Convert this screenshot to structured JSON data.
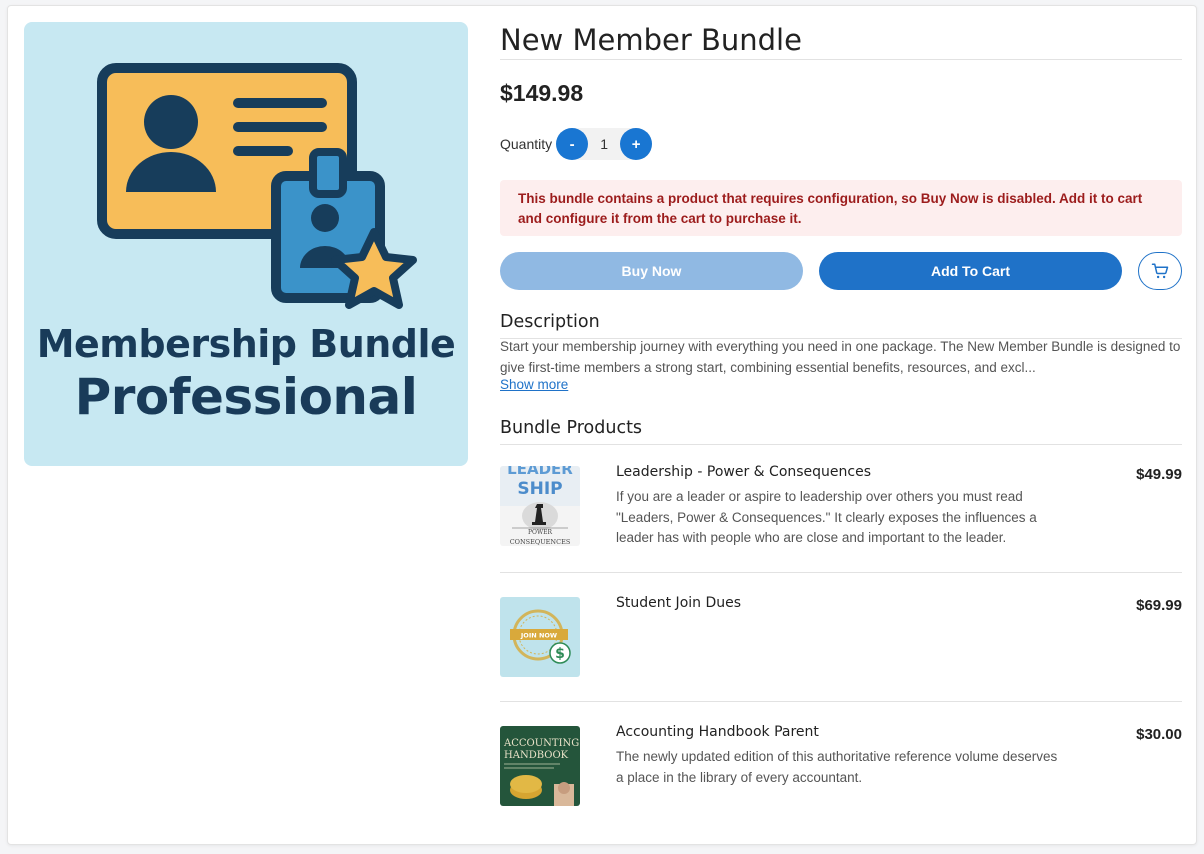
{
  "product": {
    "image_text_line1": "Membership Bundle",
    "image_text_line2": "Professional",
    "title": "New Member Bundle",
    "price": "$149.98"
  },
  "quantity": {
    "label": "Quantity",
    "decrement_label": "-",
    "value": "1",
    "increment_label": "+"
  },
  "alert": {
    "message": "This bundle contains a product that requires configuration, so Buy Now is disabled. Add it to cart and configure it from the cart to purchase it."
  },
  "actions": {
    "buy_now_label": "Buy Now",
    "buy_now_disabled": true,
    "add_to_cart_label": "Add To Cart",
    "cart_icon": "cart-icon"
  },
  "description": {
    "heading": "Description",
    "text": "Start your membership journey with everything you need in one package. The New Member Bundle is designed to give first-time members a strong start, combining essential benefits, resources, and excl...",
    "show_more_label": "Show more"
  },
  "bundle": {
    "heading": "Bundle Products",
    "items": [
      {
        "name": "Leadership - Power & Consequences",
        "description": "If you are a leader or aspire to leadership over others you must read \"Leaders, Power & Consequences.\" It clearly exposes the influences a leader has with people who are close and important to the leader.",
        "price": "$49.99",
        "thumb_text_top": "LEADER",
        "thumb_text_mid": "SHIP",
        "thumb_text_power": "POWER",
        "thumb_text_bottom": "CONSEQUENCES"
      },
      {
        "name": "Student Join Dues",
        "description": "",
        "price": "$69.99",
        "thumb_text": "JOIN NOW"
      },
      {
        "name": "Accounting Handbook Parent",
        "description": "The newly updated edition of this authoritative reference volume deserves a place in the library of every accountant.",
        "price": "$30.00",
        "thumb_text_line1": "ACCOUNTING",
        "thumb_text_line2": "HANDBOOK"
      }
    ]
  },
  "colors": {
    "primary": "#1f72c8",
    "primary_disabled": "#90b9e3",
    "alert_bg": "#fdeeee",
    "alert_text": "#9c1c1c",
    "hero_bg": "#c7e8f2",
    "hero_text": "#193b59"
  }
}
